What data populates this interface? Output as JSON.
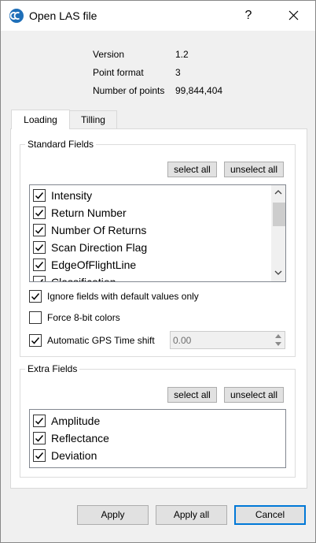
{
  "window": {
    "title": "Open LAS file",
    "help_glyph": "?",
    "icon": "cloudcompare-logo-icon"
  },
  "info": [
    {
      "label": "Version",
      "value": "1.2"
    },
    {
      "label": "Point format",
      "value": "3"
    },
    {
      "label": "Number of points",
      "value": "99,844,404"
    }
  ],
  "tabs": [
    {
      "label": "Loading",
      "active": true
    },
    {
      "label": "Tilling",
      "active": false
    }
  ],
  "standard_fields": {
    "title": "Standard Fields",
    "select_all": "select all",
    "unselect_all": "unselect all",
    "items": [
      {
        "label": "Intensity",
        "checked": true
      },
      {
        "label": "Return Number",
        "checked": true
      },
      {
        "label": "Number Of Returns",
        "checked": true
      },
      {
        "label": "Scan Direction Flag",
        "checked": true
      },
      {
        "label": "EdgeOfFlightLine",
        "checked": true
      },
      {
        "label": "Classification",
        "checked": true
      }
    ]
  },
  "options": {
    "ignore_default": {
      "label": "Ignore fields with default values only",
      "checked": true
    },
    "force_8bit": {
      "label": "Force 8-bit colors",
      "checked": false
    },
    "gps_shift": {
      "label": "Automatic GPS Time shift",
      "checked": true,
      "value": "0.00"
    }
  },
  "extra_fields": {
    "title": "Extra Fields",
    "select_all": "select all",
    "unselect_all": "unselect all",
    "items": [
      {
        "label": "Amplitude",
        "checked": true
      },
      {
        "label": "Reflectance",
        "checked": true
      },
      {
        "label": "Deviation",
        "checked": true
      }
    ]
  },
  "buttons": {
    "apply": "Apply",
    "apply_all": "Apply all",
    "cancel": "Cancel"
  },
  "colors": {
    "accent": "#0078d7",
    "logo": "#1e6fb8"
  }
}
